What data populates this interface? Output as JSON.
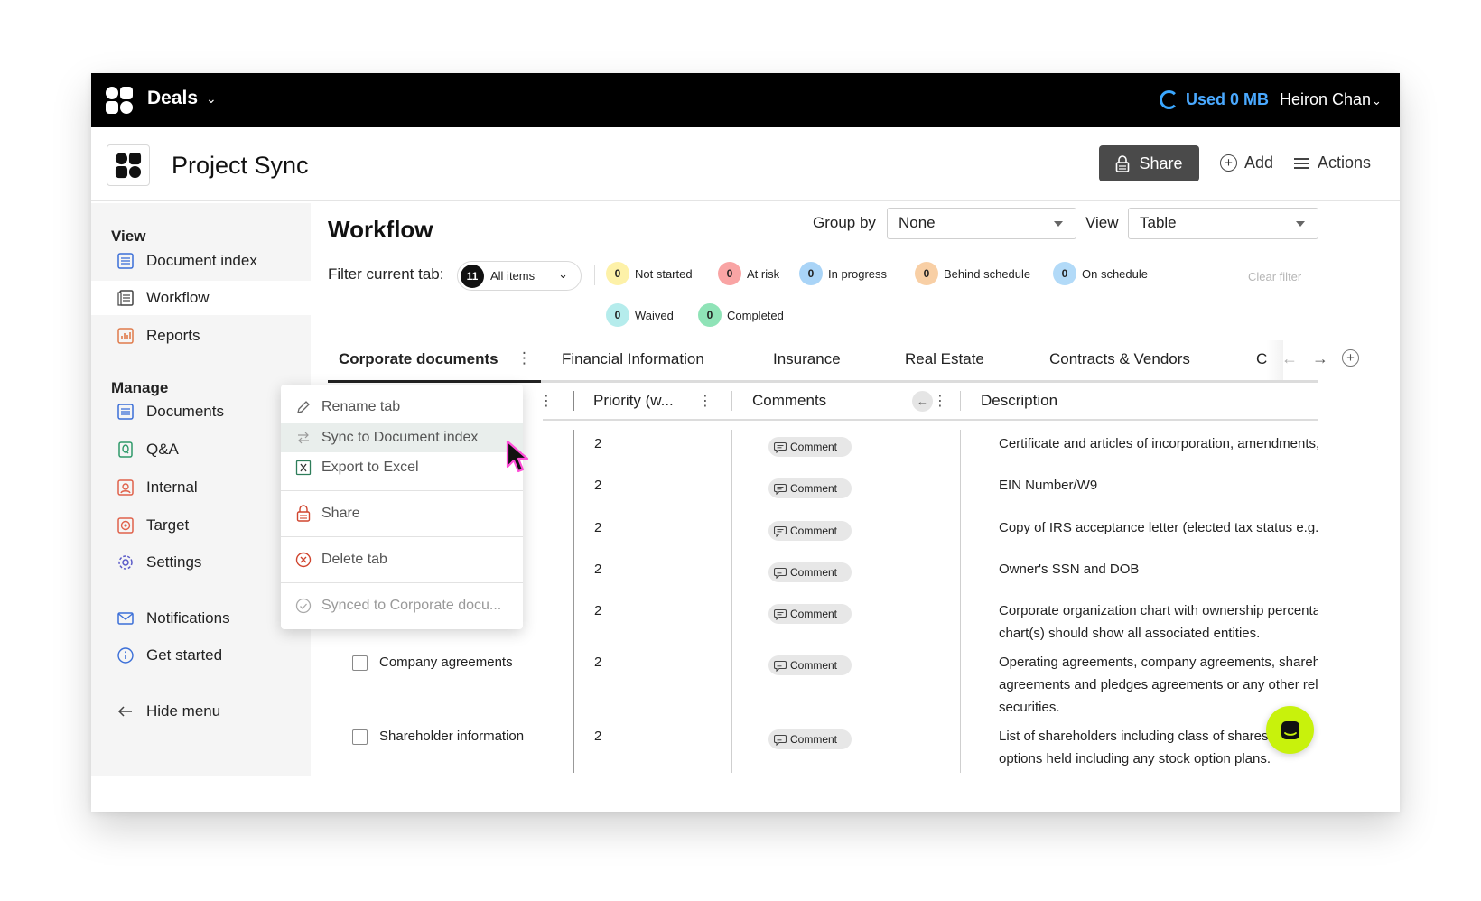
{
  "topbar": {
    "app_title": "Deals",
    "usage_text": "Used 0 MB",
    "user_name": "Heiron Chan"
  },
  "project": {
    "title": "Project Sync",
    "share_label": "Share",
    "add_label": "Add",
    "actions_label": "Actions"
  },
  "sidebar": {
    "view_heading": "View",
    "view_items": [
      {
        "label": "Document index"
      },
      {
        "label": "Workflow"
      },
      {
        "label": "Reports"
      }
    ],
    "manage_heading": "Manage",
    "manage_items": [
      {
        "label": "Documents"
      },
      {
        "label": "Q&A"
      },
      {
        "label": "Internal"
      },
      {
        "label": "Target"
      },
      {
        "label": "Settings"
      }
    ],
    "notifications_label": "Notifications",
    "get_started_label": "Get started",
    "hide_menu_label": "Hide menu"
  },
  "main": {
    "title": "Workflow",
    "group_by_label": "Group by",
    "group_by_value": "None",
    "view_label": "View",
    "view_value": "Table",
    "filter_label": "Filter current tab:",
    "all_items": {
      "count": "11",
      "label": "All items"
    },
    "statuses": [
      {
        "count": "0",
        "label": "Not started",
        "color": "#fdf1a8"
      },
      {
        "count": "0",
        "label": "At risk",
        "color": "#f9a4a4"
      },
      {
        "count": "0",
        "label": "In progress",
        "color": "#a9d4f7"
      },
      {
        "count": "0",
        "label": "Behind schedule",
        "color": "#f8cfa5"
      },
      {
        "count": "0",
        "label": "On schedule",
        "color": "#b2daf8"
      },
      {
        "count": "0",
        "label": "Waived",
        "color": "#b5ecec"
      },
      {
        "count": "0",
        "label": "Completed",
        "color": "#8fe3b7"
      }
    ],
    "clear_filter": "Clear filter",
    "tabs": [
      {
        "label": "Corporate documents"
      },
      {
        "label": "Financial Information"
      },
      {
        "label": "Insurance"
      },
      {
        "label": "Real Estate"
      },
      {
        "label": "Contracts & Vendors"
      },
      {
        "label": "C"
      }
    ]
  },
  "table": {
    "headers": {
      "priority": "Priority (w...",
      "comments": "Comments",
      "description": "Description"
    },
    "comment_label": "Comment",
    "rows": [
      {
        "name": "",
        "priority": "2",
        "desc": [
          "Certificate and articles of incorporation, amendments, a"
        ]
      },
      {
        "name": "",
        "priority": "2",
        "desc": [
          "EIN Number/W9"
        ]
      },
      {
        "name": "",
        "priority": "2",
        "desc": [
          "Copy of IRS acceptance letter (elected tax status e.g., s"
        ]
      },
      {
        "name": "",
        "priority": "2",
        "desc": [
          "Owner's SSN and DOB"
        ]
      },
      {
        "name": "",
        "priority": "2",
        "desc": [
          "Corporate organization chart with ownership percentag",
          "chart(s) should show all associated entities."
        ]
      },
      {
        "name": "Company agreements",
        "priority": "2",
        "desc": [
          "Operating agreements, company agreements, sharehol",
          "agreements and pledges agreements or any other relat",
          "securities."
        ]
      },
      {
        "name": "Shareholder information",
        "priority": "2",
        "desc": [
          "List of shareholders including class of shares, nur",
          "options held including any stock option plans."
        ]
      }
    ]
  },
  "context_menu": {
    "items": [
      {
        "label": "Rename tab"
      },
      {
        "label": "Sync to Document index"
      },
      {
        "label": "Export to Excel"
      },
      {
        "label": "Share"
      },
      {
        "label": "Delete tab"
      },
      {
        "label": "Synced to Corporate docu..."
      }
    ]
  }
}
